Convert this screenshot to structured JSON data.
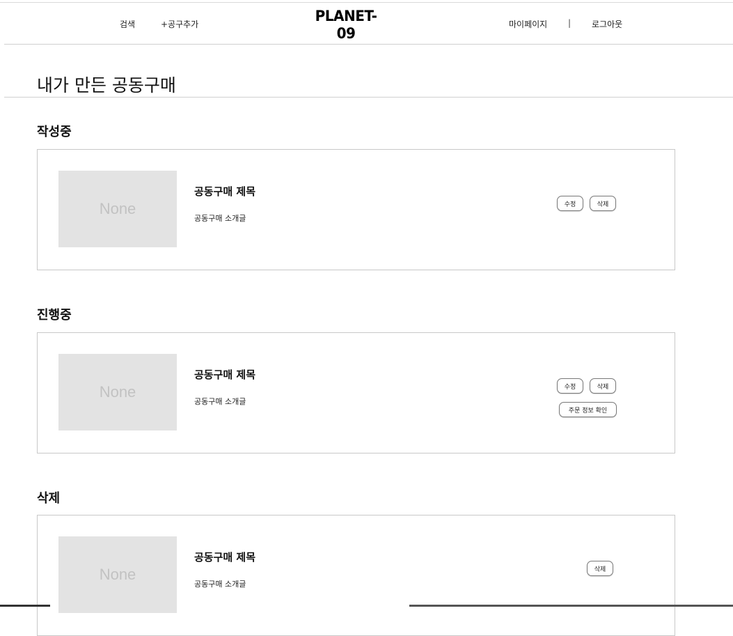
{
  "header": {
    "search_label": "검색",
    "add_label": "+공구추가",
    "logo": "PLANET-09",
    "mypage_label": "마이페이지",
    "separator": "|",
    "logout_label": "로그아웃"
  },
  "page": {
    "title": "내가 만든 공동구매"
  },
  "sections": [
    {
      "title": "작성중",
      "item": {
        "thumb_text": "None",
        "title": "공동구매 제목",
        "description": "공동구매 소개글",
        "edit_label": "수정",
        "delete_label": "삭제"
      }
    },
    {
      "title": "진행중",
      "item": {
        "thumb_text": "None",
        "title": "공동구매 제목",
        "description": "공동구매 소개글",
        "edit_label": "수정",
        "delete_label": "삭제",
        "order_info_label": "주문 정보 확인"
      }
    },
    {
      "title": "삭제",
      "item": {
        "thumb_text": "None",
        "title": "공동구매 제목",
        "description": "공동구매 소개글",
        "delete_label": "삭제"
      }
    }
  ]
}
